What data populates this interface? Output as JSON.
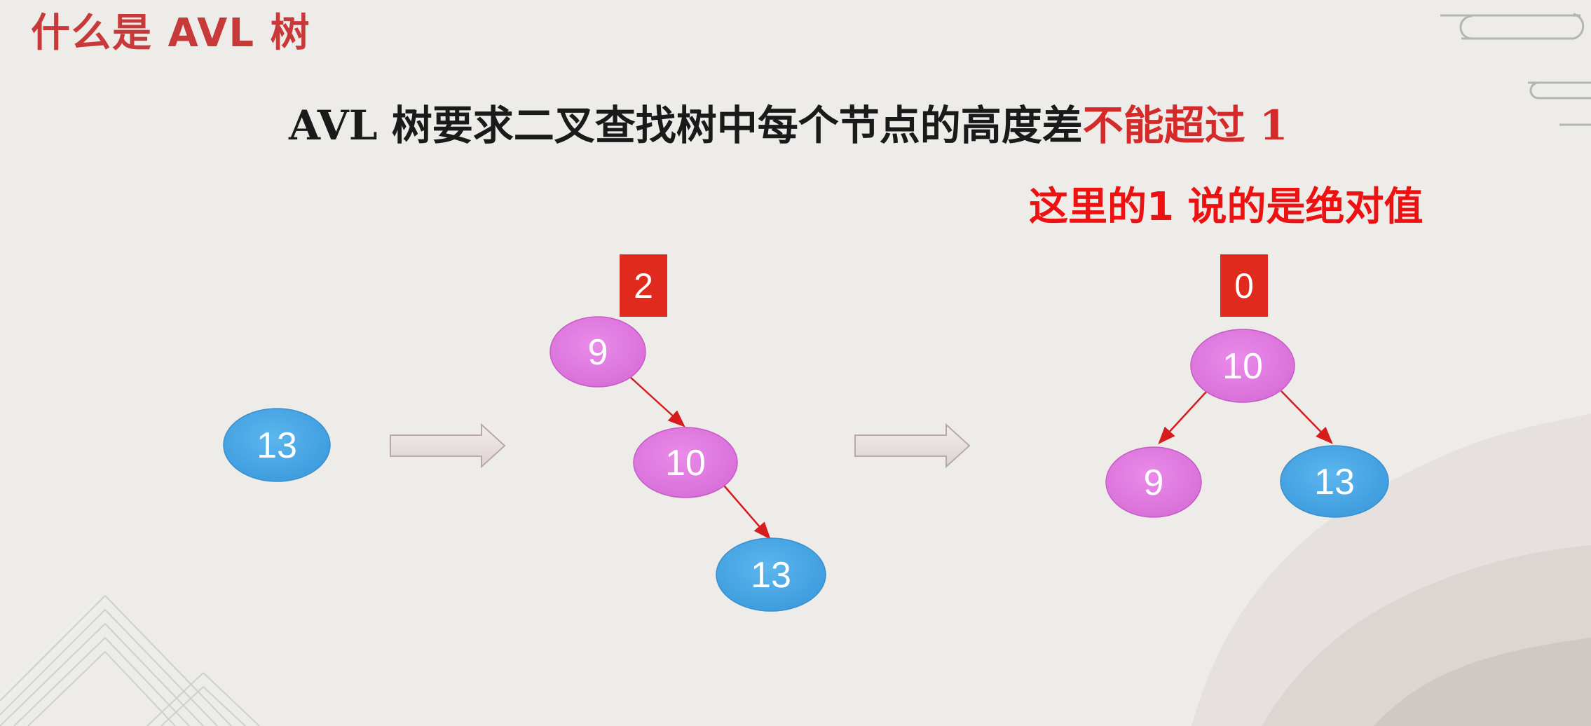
{
  "header": {
    "title": "什么是 AVL 树",
    "heading_prefix": "AVL 树要求二叉查找树中每个节点的高度差",
    "heading_highlight": "不能超过 1",
    "note": "这里的1 说的是绝对值"
  },
  "colors": {
    "title": "#c83a3a",
    "highlight": "#d42a2a",
    "note": "#ee1111",
    "blue_node": "#4aa7e4",
    "pink_node": "#e07ae0",
    "badge": "#e02a1e",
    "edge": "#d61c1c"
  },
  "diagram": {
    "step1": {
      "node": "13"
    },
    "step2": {
      "badge": "2",
      "nodes": {
        "root": "9",
        "mid": "10",
        "leaf": "13"
      }
    },
    "step3": {
      "badge": "0",
      "nodes": {
        "root": "10",
        "left": "9",
        "right": "13"
      }
    },
    "arrows": [
      "right-arrow",
      "right-arrow"
    ]
  }
}
